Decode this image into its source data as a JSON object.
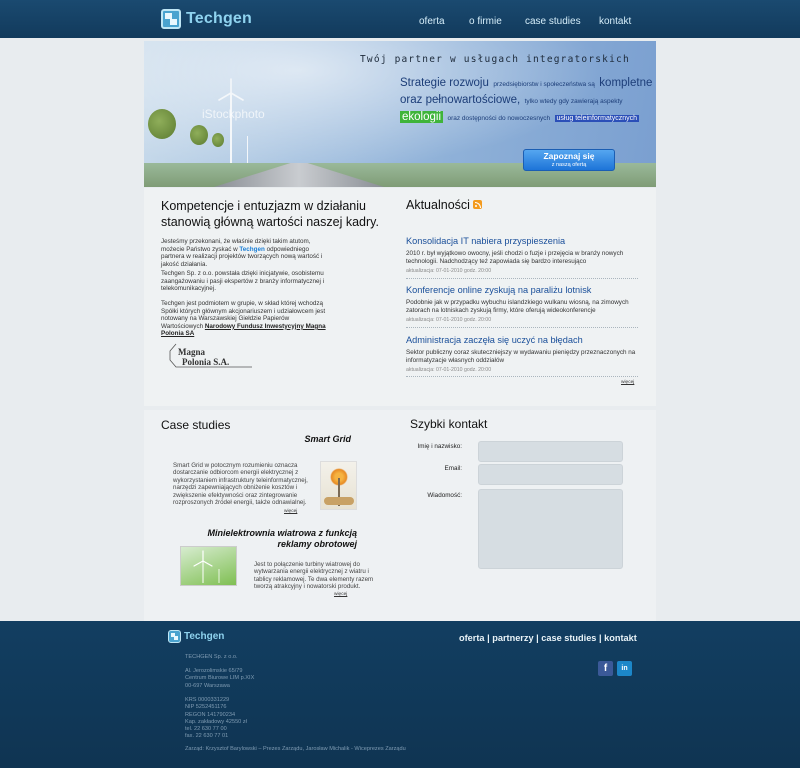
{
  "header": {
    "logo_text": "Techgen",
    "nav": [
      {
        "label": "oferta"
      },
      {
        "label": "o firmie"
      },
      {
        "label": "case studies"
      },
      {
        "label": "kontakt"
      }
    ]
  },
  "hero": {
    "watermark": "iStockphoto",
    "tagline": "Twój partner w usługach integratorskich",
    "line1_a": "Strategie rozwoju",
    "line1_b": "przedsiębiorstw i społeczeństwa są",
    "line1_c": "kompletne",
    "line2_a": "oraz pełnowartościowe,",
    "line2_b": "tylko wtedy gdy zawierają aspekty",
    "eco": "ekologii",
    "line3_b": "oraz dostępności do nowoczesnych",
    "tele": "usług teleinformatycznych",
    "cta_line1": "Zapoznaj się",
    "cta_line2": "z naszą ofertą"
  },
  "about": {
    "title": "Kompetencje i entuzjazm w działaniu stanowią główną wartości naszej kadry.",
    "p1_a": "Jesteśmy przekonani, że właśnie dzięki takim atutom, możecie Państwo zyskać w",
    "p1_hl": "Techgen",
    "p1_b": "odpowiedniego partnera w realizacji projektów tworzących nową wartość i jakość działania.",
    "p2": "Techgen Sp. z o.o. powstała dzięki inicjatywie, osobistemu zaangażowaniu i pasji ekspertów z branży informatycznej i telekomunikacyjnej.",
    "p3": "Techgen jest podmiotem w grupie, w skład której wchodzą Spółki których głównym akcjonariuszem i udziałowcem jest notowany na Warszawskiej Giełdzie Papierów Wartościowych",
    "p3_fund": "Narodowy Fundusz Inwestycyjny Magna Polonia SA",
    "magna_line1": "Magna",
    "magna_line2": "Polonia S.A."
  },
  "news": {
    "title": "Aktualności",
    "items": [
      {
        "title": "Konsolidacja IT nabiera przyspieszenia",
        "body": "2010 r. był wyjątkowo owocny, jeśli chodzi o fuzje i przejęcia w branży nowych technologii. Nadchodzący też zapowiada się bardzo interesująco",
        "date": "aktualizacja: 07-01-2010 godz. 20:00"
      },
      {
        "title": "Konferencje online zyskują na paraliżu lotnisk",
        "body": "Podobnie jak w przypadku wybuchu islandzkiego wulkanu wiosną, na zimowych zatorach na lotniskach zyskują firmy, które oferują wideokonferencje",
        "date": "aktualizacja: 07-01-2010 godz. 20:00"
      },
      {
        "title": "Administracja zaczęła się uczyć na błędach",
        "body": "Sektor publiczny coraz skuteczniejszy w wydawaniu pieniędzy przeznaczonych na informatyzacje własnych oddziałów",
        "date": "aktualizacja: 07-01-2010 godz. 20:00"
      }
    ],
    "more": "więcej"
  },
  "cases": {
    "title": "Case studies",
    "items": [
      {
        "title": "Smart Grid",
        "body": "Smart Grid w potocznym rozumieniu oznacza dostarczanie odbiorcom energii elektrycznej z wykorzystaniem infrastruktury teleinformatycznej, narzędzi zapewniających obniżenie kosztów i zwiększenie efektywności oraz zintegrowanie rozproszonych źródeł energii, także odnawialnej.",
        "more": "więcej"
      },
      {
        "title_line1": "Minielektrownia wiatrowa z funkcją",
        "title_line2": "reklamy obrotowej",
        "body": "Jest to połączenie turbiny wiatrowej do wytwarzania energii elektrycznej z wiatru i tablicy reklamowej. Te dwa elementy razem tworzą atrakcyjny i nowatorski produkt.",
        "more": "więcej"
      }
    ]
  },
  "contact": {
    "title": "Szybki kontakt",
    "name_label": "Imię i nazwisko:",
    "email_label": "Email:",
    "message_label": "Wiadomość:"
  },
  "footer": {
    "logo_text": "Techgen",
    "nav": [
      "oferta",
      "partnerzy",
      "case studies",
      "kontakt"
    ],
    "nav_sep": " | ",
    "company": "TECHGEN Sp. z o.o.",
    "address": [
      "Al. Jerozolimskie 65/79",
      "Centrum Biurowe LIM p.XIX",
      "00-697 Warszawa"
    ],
    "registry": [
      "KRS 0000331229",
      "NIP 5252451176",
      "REGON 141790234",
      "Kap. zakładowy 42550 zł",
      "tel. 22 630 77 00",
      "fax. 22 630 77 01"
    ],
    "board": "Zarząd: Krzysztof Barylowski – Prezes Zarządu, Jarosław Michalik - Wiceprezes Zarządu",
    "social": [
      {
        "icon": "facebook-icon",
        "glyph": "f"
      },
      {
        "icon": "linkedin-icon",
        "glyph": "in"
      }
    ]
  }
}
